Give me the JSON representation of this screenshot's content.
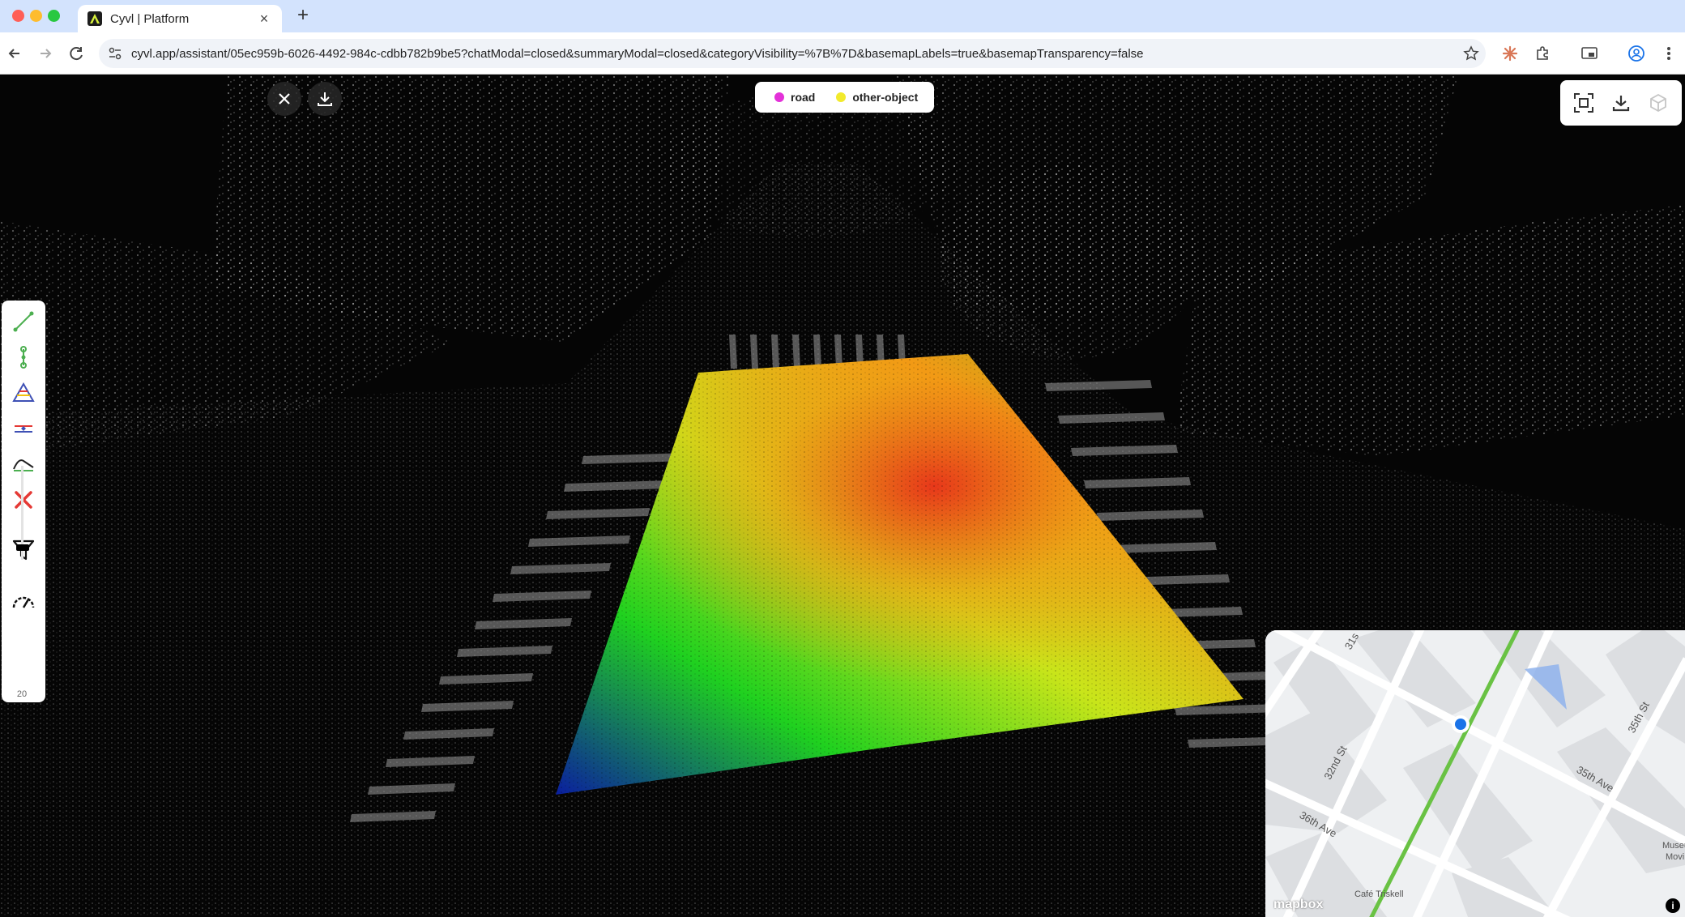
{
  "browser": {
    "tab_title": "Cyvl | Platform",
    "new_tab_label": "+",
    "tab_close_label": "×",
    "url": "cyvl.app/assistant/05ec959b-6026-4492-984c-cdbb782b9be5?chatModal=closed&summaryModal=closed&categoryVisibility=%7B%7D&basemapLabels=true&basemapTransparency=false"
  },
  "viewer": {
    "legend": [
      {
        "label": "road",
        "color": "#e331d8"
      },
      {
        "label": "other-object",
        "color": "#f2ea2c"
      }
    ],
    "point_size_value": "20",
    "point_size_level": 0.1,
    "heatmap_colors": [
      "#0a1ea0",
      "#1fd11f",
      "#c9e51a",
      "#f29a15",
      "#e8301a"
    ]
  },
  "minimap": {
    "labels": {
      "s31": "31s",
      "st35": "35th St",
      "st32": "32nd St",
      "ave35": "35th Ave",
      "ave36": "36th Ave",
      "cafe": "Café Triskell",
      "museum1": "Museu",
      "museum2": "Movir",
      "mapbox": "mapbox"
    },
    "route_color": "#69c244",
    "location_color": "#1a73e8"
  }
}
